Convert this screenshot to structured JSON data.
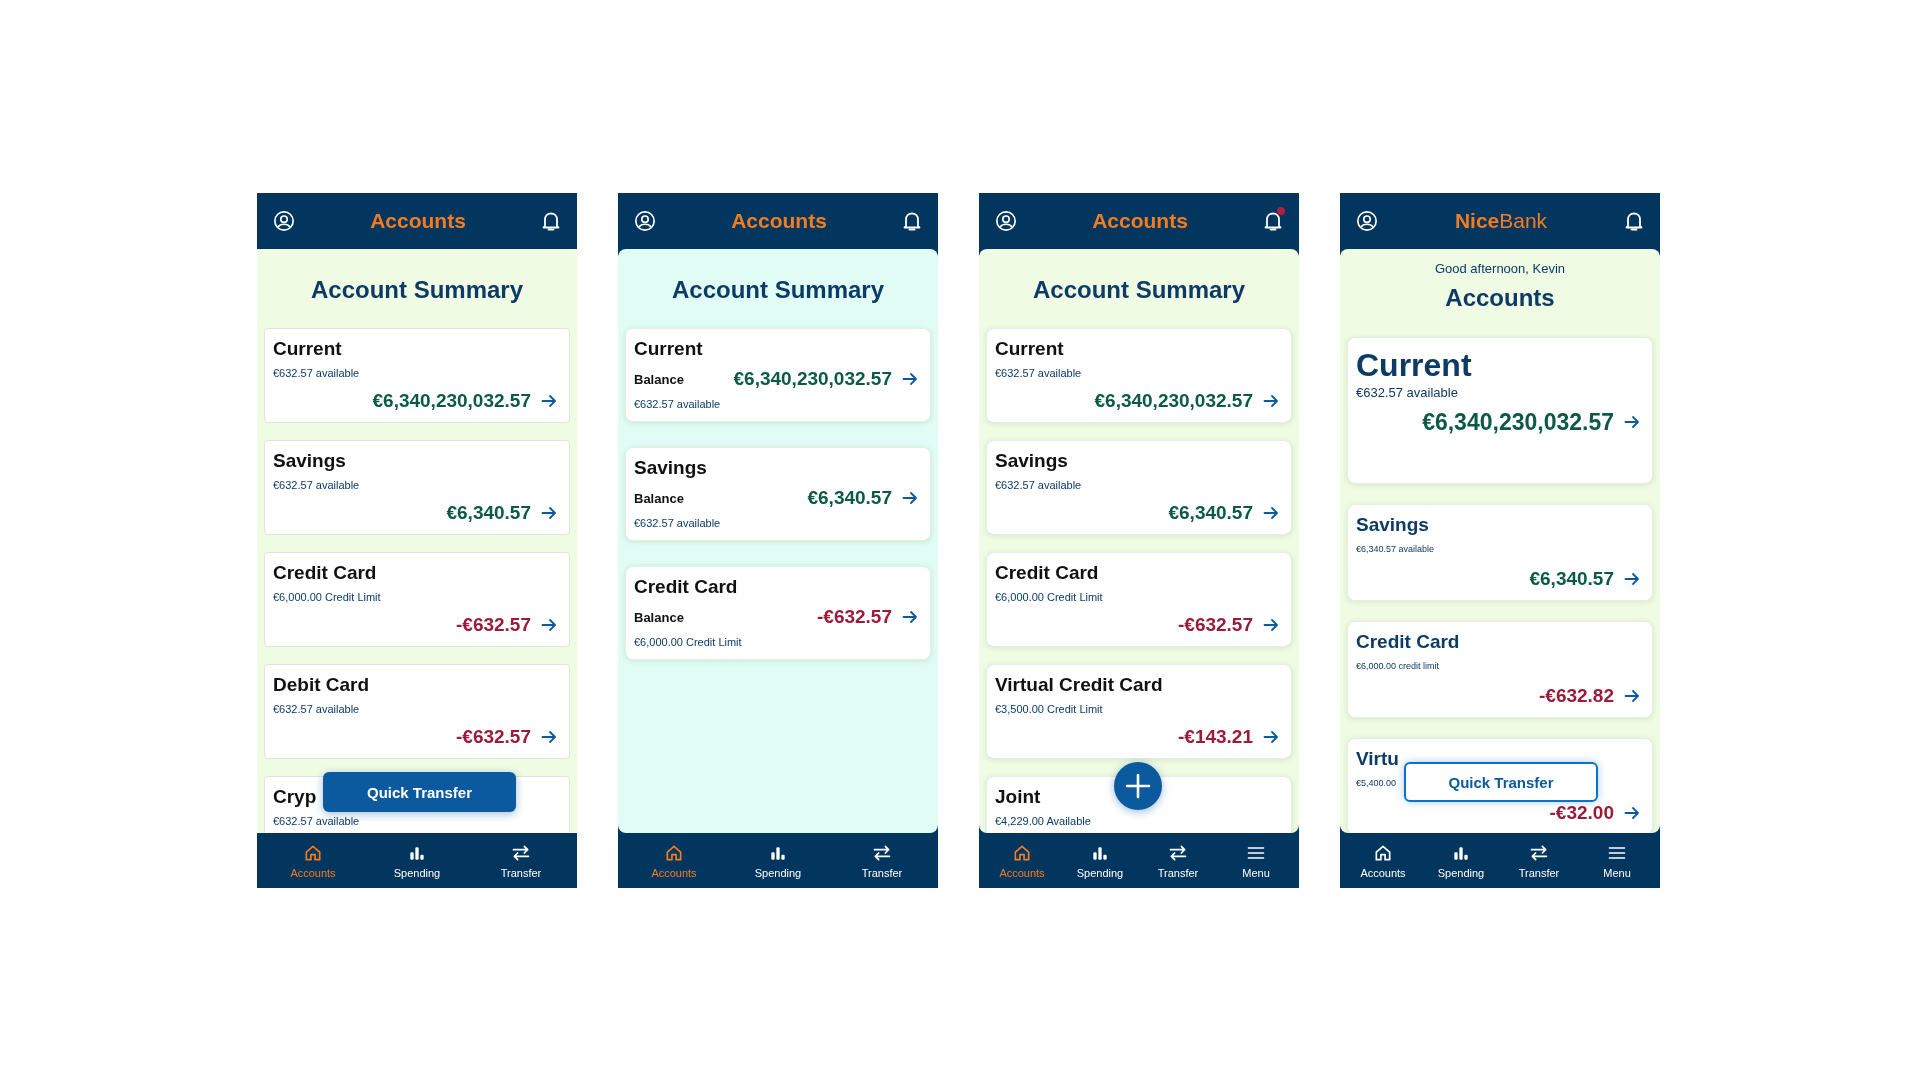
{
  "screens": [
    {
      "kind": "classic",
      "header": {
        "title": "Accounts"
      },
      "heading": "Account Summary",
      "cards": [
        {
          "kind": "standard",
          "name": "Current",
          "note": "€632.57 available",
          "amount": "€6,340,230,032.57",
          "negative": false
        },
        {
          "kind": "standard",
          "name": "Savings",
          "note": "€632.57 available",
          "amount": "€6,340.57",
          "negative": false
        },
        {
          "kind": "standard",
          "name": "Credit Card",
          "note": "€6,000.00 Credit Limit",
          "amount": "-€632.57",
          "negative": true
        },
        {
          "kind": "standard",
          "name": "Debit Card",
          "note": "€632.57 available",
          "amount": "-€632.57",
          "negative": true
        },
        {
          "kind": "partial",
          "name": "Cryp",
          "note": "€632.57 available"
        }
      ],
      "fab": {
        "kind": "filled",
        "label": "Quick Transfer"
      },
      "nav": [
        {
          "kind": "home",
          "label": "Accounts",
          "selected": true
        },
        {
          "kind": "chart",
          "label": "Spending",
          "selected": false
        },
        {
          "kind": "transfer",
          "label": "Transfer",
          "selected": false
        }
      ]
    },
    {
      "kind": "balance",
      "header": {
        "title": "Accounts"
      },
      "heading": "Account Summary",
      "cards": [
        {
          "kind": "balance",
          "name": "Current",
          "label": "Balance",
          "amount": "€6,340,230,032.57",
          "note": "€632.57 available",
          "negative": false
        },
        {
          "kind": "balance",
          "name": "Savings",
          "label": "Balance",
          "amount": "€6,340.57",
          "note": "€632.57 available",
          "negative": false
        },
        {
          "kind": "balance",
          "name": "Credit Card",
          "label": "Balance",
          "amount": "-€632.57",
          "note": "€6,000.00 Credit Limit",
          "negative": true
        }
      ],
      "nav": [
        {
          "kind": "home",
          "label": "Accounts",
          "selected": true
        },
        {
          "kind": "chart",
          "label": "Spending",
          "selected": false
        },
        {
          "kind": "transfer",
          "label": "Transfer",
          "selected": false
        }
      ]
    },
    {
      "kind": "rounded",
      "header": {
        "title": "Accounts",
        "notification": true
      },
      "heading": "Account Summary",
      "cards": [
        {
          "kind": "standard",
          "name": "Current",
          "note": "€632.57 available",
          "amount": "€6,340,230,032.57",
          "negative": false
        },
        {
          "kind": "standard",
          "name": "Savings",
          "note": "€632.57 available",
          "amount": "€6,340.57",
          "negative": false
        },
        {
          "kind": "standard",
          "name": "Credit Card",
          "note": "€6,000.00 Credit Limit",
          "amount": "-€632.57",
          "negative": true
        },
        {
          "kind": "standard",
          "name": "Virtual Credit Card",
          "note": "€3,500.00 Credit Limit",
          "amount": "-€143.21",
          "negative": true
        },
        {
          "kind": "partial",
          "name": "Joint",
          "note": "€4,229.00 Available"
        }
      ],
      "fab": {
        "kind": "plus"
      },
      "nav": [
        {
          "kind": "home",
          "label": "Accounts",
          "selected": true
        },
        {
          "kind": "chart",
          "label": "Spending",
          "selected": false
        },
        {
          "kind": "transfer",
          "label": "Transfer",
          "selected": false
        },
        {
          "kind": "menu",
          "label": "Menu",
          "selected": false
        }
      ]
    },
    {
      "kind": "branded",
      "header": {
        "title": "**Nice**Bank"
      },
      "greeting": "Good afternoon, Kevin",
      "heading": "Accounts",
      "cards": [
        {
          "kind": "featured",
          "name": "Current",
          "note": "€632.57 available",
          "amount": "€6,340,230,032.57",
          "negative": false
        },
        {
          "kind": "standard",
          "name": "Savings",
          "note": "€6,340.57 available",
          "amount": "€6,340.57",
          "negative": false
        },
        {
          "kind": "standard",
          "name": "Credit Card",
          "note": "€6,000.00 credit limit",
          "amount": "-€632.82",
          "negative": true
        },
        {
          "kind": "standard",
          "name": "Virtu",
          "note": "€5,400.00",
          "amount": "-€32.00",
          "negative": true
        }
      ],
      "fab": {
        "kind": "outlined",
        "label": "Quick Transfer"
      },
      "nav": [
        {
          "kind": "home",
          "label": "Accounts",
          "selected": false
        },
        {
          "kind": "chart",
          "label": "Spending",
          "selected": false
        },
        {
          "kind": "transfer",
          "label": "Transfer",
          "selected": false
        },
        {
          "kind": "menu",
          "label": "Menu",
          "selected": false
        }
      ]
    }
  ]
}
